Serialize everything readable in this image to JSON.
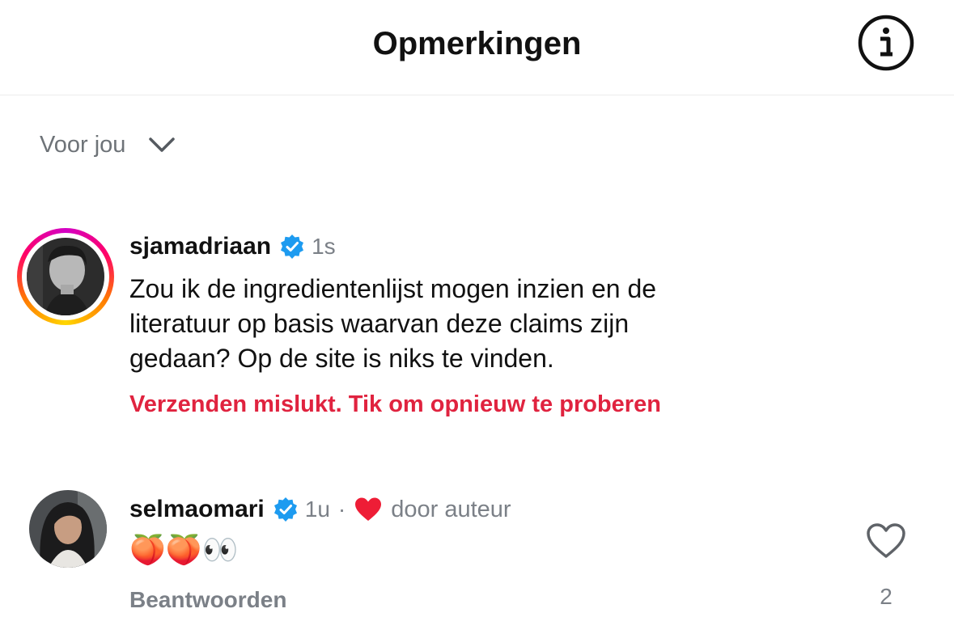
{
  "header": {
    "title": "Opmerkingen",
    "info_icon": "info-circle-icon"
  },
  "sort": {
    "label": "Voor jou",
    "icon": "chevron-down-icon"
  },
  "comments": [
    {
      "username": "sjamadriaan",
      "verified": true,
      "time": "1s",
      "text_lines": [
        "Zou ik de ingredientenlijst mogen inzien en de",
        "literatuur op basis waarvan deze claims zijn",
        "gedaan? Op de site is niks te vinden."
      ],
      "error": "Verzenden mislukt. Tik om opnieuw te proberen",
      "has_story_ring": true
    },
    {
      "username": "selmaomari",
      "verified": true,
      "time": "1u",
      "separator": "·",
      "liked_by_author_label": "door auteur",
      "emojis": "🍑🍑👀",
      "reply_label": "Beantwoorden",
      "like_count": "2"
    }
  ],
  "colors": {
    "accent_blue": "#1d9bf0",
    "error_red": "#e0233f",
    "heart_red": "#ee1d36",
    "muted_gray": "#7b8087"
  }
}
